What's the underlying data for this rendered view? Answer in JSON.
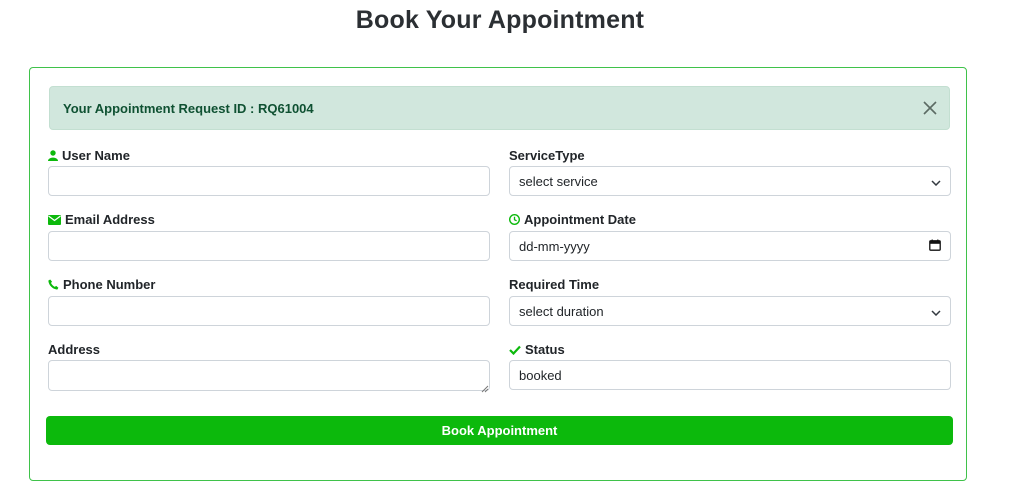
{
  "page": {
    "title": "Book Your Appointment"
  },
  "alert": {
    "text": "Your Appointment Request ID : RQ61004",
    "close_icon": "close-icon"
  },
  "form": {
    "user_name": {
      "label": "User Name",
      "value": "",
      "icon": "user-icon"
    },
    "email": {
      "label": "Email Address",
      "value": "",
      "icon": "envelope-icon"
    },
    "phone": {
      "label": "Phone Number",
      "value": "",
      "icon": "phone-icon"
    },
    "address": {
      "label": "Address",
      "value": ""
    },
    "service_type": {
      "label": "ServiceType",
      "selected": "select service",
      "icon": "chevron-down-icon"
    },
    "appointment_date": {
      "label": "Appointment Date",
      "placeholder": "dd-mm-yyyy",
      "icon": "clock-icon",
      "picker_icon": "calendar-icon"
    },
    "required_time": {
      "label": "Required Time",
      "selected": "select duration",
      "icon": "chevron-down-icon"
    },
    "status": {
      "label": "Status",
      "value": "booked",
      "icon": "check-icon"
    },
    "submit_label": "Book Appointment"
  },
  "colors": {
    "accent_green": "#0cb90c",
    "alert_bg": "#d1e7dd",
    "alert_text": "#0f5132",
    "card_border": "#3fc24a"
  }
}
